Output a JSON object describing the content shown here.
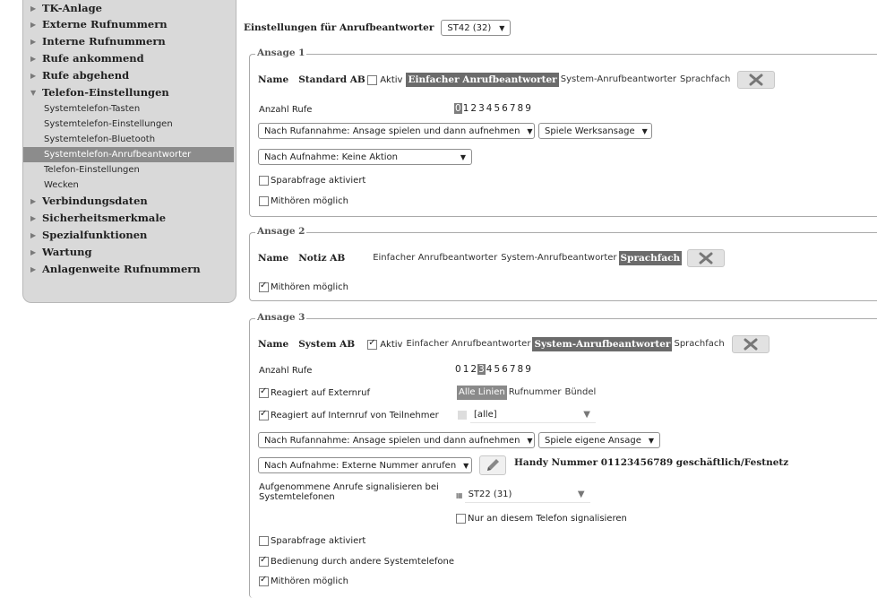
{
  "sidebar": {
    "items": [
      {
        "label": "TK-Anlage"
      },
      {
        "label": "Externe Rufnummern"
      },
      {
        "label": "Interne Rufnummern"
      },
      {
        "label": "Rufe ankommend"
      },
      {
        "label": "Rufe abgehend"
      },
      {
        "label": "Telefon-Einstellungen",
        "expanded": true
      }
    ],
    "sub_items": [
      {
        "label": "Systemtelefon-Tasten"
      },
      {
        "label": "Systemtelefon-Einstellungen"
      },
      {
        "label": "Systemtelefon-Bluetooth"
      },
      {
        "label": "Systemtelefon-Anrufbeantworter",
        "selected": true
      },
      {
        "label": "Telefon-Einstellungen"
      },
      {
        "label": "Wecken"
      }
    ],
    "items_after": [
      {
        "label": "Verbindungsdaten"
      },
      {
        "label": "Sicherheitsmerkmale"
      },
      {
        "label": "Spezialfunktionen"
      },
      {
        "label": "Wartung"
      },
      {
        "label": "Anlagenweite Rufnummern"
      }
    ]
  },
  "header": {
    "label": "Einstellungen für Anrufbeantworter",
    "device_select": "ST42 (32)"
  },
  "common": {
    "name_label": "Name",
    "aktiv_label": "Aktiv",
    "modes": [
      "Einfacher Anrufbeantworter",
      "System-Anrufbeantworter",
      "Sprachfach"
    ],
    "anzahl_rufe_label": "Anzahl Rufe",
    "digits": [
      "0",
      "1",
      "2",
      "3",
      "4",
      "5",
      "6",
      "7",
      "8",
      "9"
    ],
    "sparabfrage_label": "Sparabfrage aktiviert",
    "mithoeren_label": "Mithören möglich"
  },
  "ansage1": {
    "title": "Ansage 1",
    "name": "Standard AB",
    "aktiv": false,
    "active_mode": 0,
    "selected_digit": 0,
    "after_call_select": "Nach Rufannahme: Ansage spielen und dann aufnehmen",
    "announcement_select": "Spiele Werksansage",
    "after_record_select": "Nach Aufnahme: Keine Aktion",
    "sparabfrage": false,
    "mithoeren": false
  },
  "ansage2": {
    "title": "Ansage 2",
    "name": "Notiz AB",
    "active_mode": 2,
    "mithoeren": true
  },
  "ansage3": {
    "title": "Ansage 3",
    "name": "System AB",
    "aktiv": true,
    "active_mode": 1,
    "selected_digit": 3,
    "reagiert_extern_label": "Reagiert auf Externruf",
    "reagiert_extern": true,
    "line_options": [
      "Alle Linien",
      "Rufnummer",
      "Bündel"
    ],
    "line_active": 0,
    "reagiert_intern_label": "Reagiert auf Internruf von Teilnehmer",
    "reagiert_intern": true,
    "teilnehmer_select": "[alle]",
    "after_call_select": "Nach Rufannahme: Ansage spielen und dann aufnehmen",
    "announcement_select": "Spiele eigene Ansage",
    "after_record_select": "Nach Aufnahme: Externe Nummer anrufen",
    "external_number_text": "Handy Nummer 01123456789 geschäftlich/Festnetz",
    "signal_label_line1": "Aufgenommene Anrufe signalisieren bei",
    "signal_label_line2": "Systemtelefonen",
    "signal_select": "ST22 (31)",
    "only_this_phone_label": "Nur an diesem Telefon signalisieren",
    "only_this_phone": false,
    "sparabfrage": false,
    "bedienung_label": "Bedienung durch andere Systemtelefone",
    "bedienung": true,
    "mithoeren": true
  }
}
